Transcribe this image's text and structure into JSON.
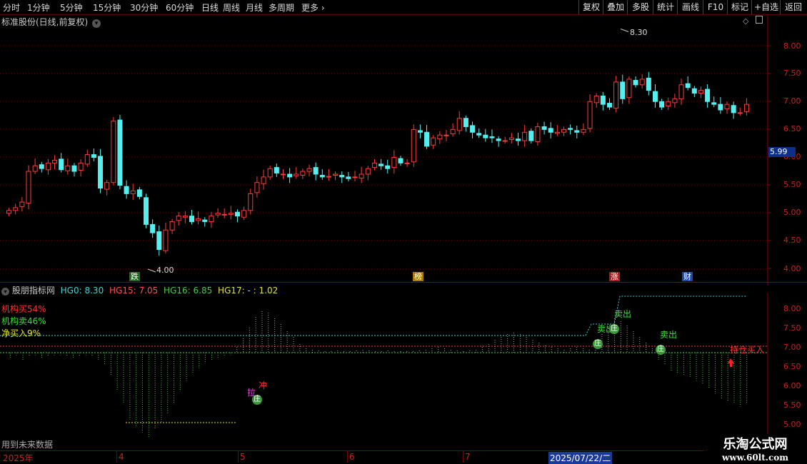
{
  "toolbar": {
    "timeframes": [
      "分时",
      "1分钟",
      "5分钟",
      "15分钟",
      "30分钟",
      "60分钟",
      "日线",
      "周线",
      "月线",
      "多周期",
      "更多"
    ],
    "right_buttons": [
      "复权",
      "叠加",
      "多股",
      "统计",
      "画线",
      "F10",
      "标记",
      "+自选",
      "返回"
    ]
  },
  "main_panel": {
    "title": "标准股份(日线,前复权)",
    "price_axis": [
      "8.00",
      "7.50",
      "7.00",
      "6.50",
      "6.00",
      "5.50",
      "5.00",
      "4.50",
      "4.00"
    ],
    "current_price": "5.99",
    "high_label": "8.30",
    "low_label": "4.00",
    "markers": [
      "跌",
      "榜",
      "涨",
      "财"
    ]
  },
  "indicator_panel": {
    "name": "股朋指标网",
    "values": [
      {
        "label": "HG0: 8.30",
        "color": "#3fd4d4"
      },
      {
        "label": "HG15: 7.05",
        "color": "#ff5050"
      },
      {
        "label": "HG16: 6.85",
        "color": "#40d040"
      },
      {
        "label": "HG17: - : 1.02",
        "color": "#e0e040"
      }
    ],
    "legend": [
      {
        "label": "机构买54%",
        "color": "#ff3030"
      },
      {
        "label": "机构卖46%",
        "color": "#30e030"
      },
      {
        "label": "净买入9%",
        "color": "#e8e820"
      }
    ],
    "axis": [
      "8.00",
      "7.50",
      "7.00",
      "6.50",
      "6.00",
      "5.50",
      "5.00"
    ],
    "annotations": {
      "la": "拉",
      "chong": "冲",
      "zhuang": "庄",
      "sell1": "卖出",
      "sell2": "卖出",
      "sell3": "卖出",
      "hold_buy": "持仓买入"
    }
  },
  "footer": {
    "note": "用到未来数据",
    "dates": [
      "2025年",
      "4",
      "5",
      "6",
      "7",
      "2025/07/22/二"
    ],
    "watermark_title": "乐淘公式网",
    "watermark_url": "www.60lt.com"
  }
}
